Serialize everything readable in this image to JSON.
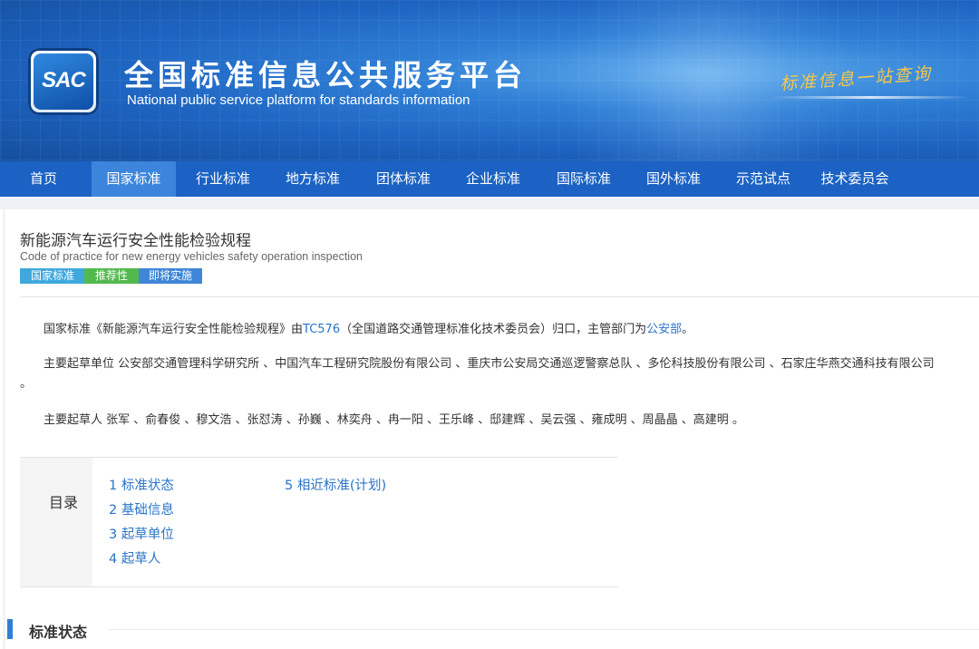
{
  "header": {
    "logo_text": "SAC",
    "title": "全国标准信息公共服务平台",
    "subtitle": "National public service platform  for standards information",
    "slogan": "标准信息一站查询"
  },
  "nav": {
    "items": [
      {
        "label": "首页",
        "active": false
      },
      {
        "label": "国家标准",
        "active": true
      },
      {
        "label": "行业标准",
        "active": false
      },
      {
        "label": "地方标准",
        "active": false
      },
      {
        "label": "团体标准",
        "active": false
      },
      {
        "label": "企业标准",
        "active": false
      },
      {
        "label": "国际标准",
        "active": false
      },
      {
        "label": "国外标准",
        "active": false
      },
      {
        "label": "示范试点",
        "active": false
      },
      {
        "label": "技术委员会",
        "active": false
      }
    ]
  },
  "standard": {
    "title": "新能源汽车运行安全性能检验规程",
    "title_en": "Code of practice for new energy vehicles safety operation inspection",
    "tags": [
      {
        "label": "国家标准",
        "color": "#3fa9dd"
      },
      {
        "label": "推荐性",
        "color": "#52b94f"
      },
      {
        "label": "即将实施",
        "color": "#3f86d8"
      }
    ],
    "description": {
      "prefix": "国家标准《新能源汽车运行安全性能检验规程》由",
      "tc_link": "TC576",
      "middle": "（全国道路交通管理标准化技术委员会）归口，主管部门为",
      "dept_link": "公安部",
      "suffix": "。"
    },
    "drafting_units_line1": "主要起草单位 公安部交通管理科学研究所 、中国汽车工程研究院股份有限公司 、重庆市公安局交通巡逻警察总队 、多伦科技股份有限公司 、石家庄华燕交通科技有限公司",
    "drafting_units_line2": "。",
    "drafters": "主要起草人 张军 、俞春俊 、穆文浩 、张怼涛 、孙巍 、林奕舟 、冉一阳 、王乐峰 、邸建辉 、吴云强 、雍成明 、周晶晶 、高建明 。"
  },
  "toc": {
    "heading": "目录",
    "items": [
      "1  标准状态",
      "2  基础信息",
      "3  起草单位",
      "4  起草人",
      "5  相近标准(计划)"
    ]
  },
  "section": {
    "title": "标准状态"
  },
  "colors": {
    "brand_blue": "#1b62c4",
    "nav_active": "#3b86dc",
    "link": "#2a74c8",
    "slogan_gold": "#f5c84a"
  }
}
